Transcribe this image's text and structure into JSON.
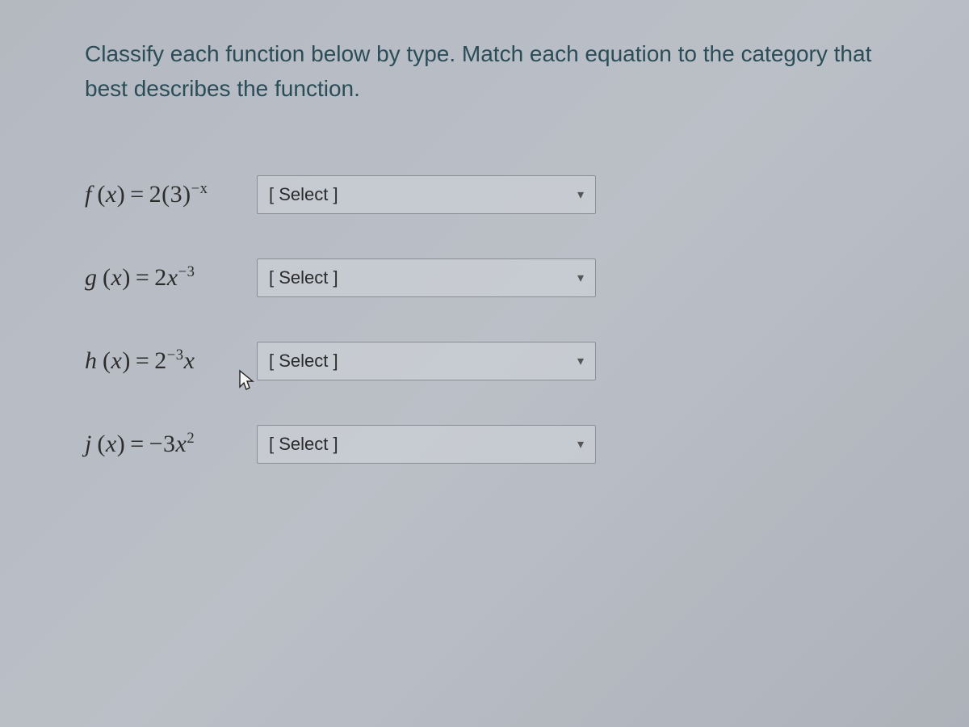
{
  "instructions": "Classify each function below by type. Match each equation to the category that best describes the function.",
  "rows": [
    {
      "func_letter": "f",
      "eq_prefix": "2(3)",
      "sup": "−x",
      "eq_suffix": "",
      "select_label": "[ Select ]",
      "has_cursor": false
    },
    {
      "func_letter": "g",
      "eq_prefix": "2",
      "mid_var": "x",
      "sup": "−3",
      "eq_suffix": "",
      "select_label": "[ Select ]",
      "has_cursor": false
    },
    {
      "func_letter": "h",
      "eq_prefix": "2",
      "sup": "−3",
      "eq_suffix_var": "x",
      "select_label": "[ Select ]",
      "has_cursor": true
    },
    {
      "func_letter": "j",
      "eq_prefix": "−3",
      "mid_var": "x",
      "sup": "2",
      "eq_suffix": "",
      "select_label": "[ Select ]",
      "has_cursor": false
    }
  ],
  "labels": {
    "x": "x"
  }
}
